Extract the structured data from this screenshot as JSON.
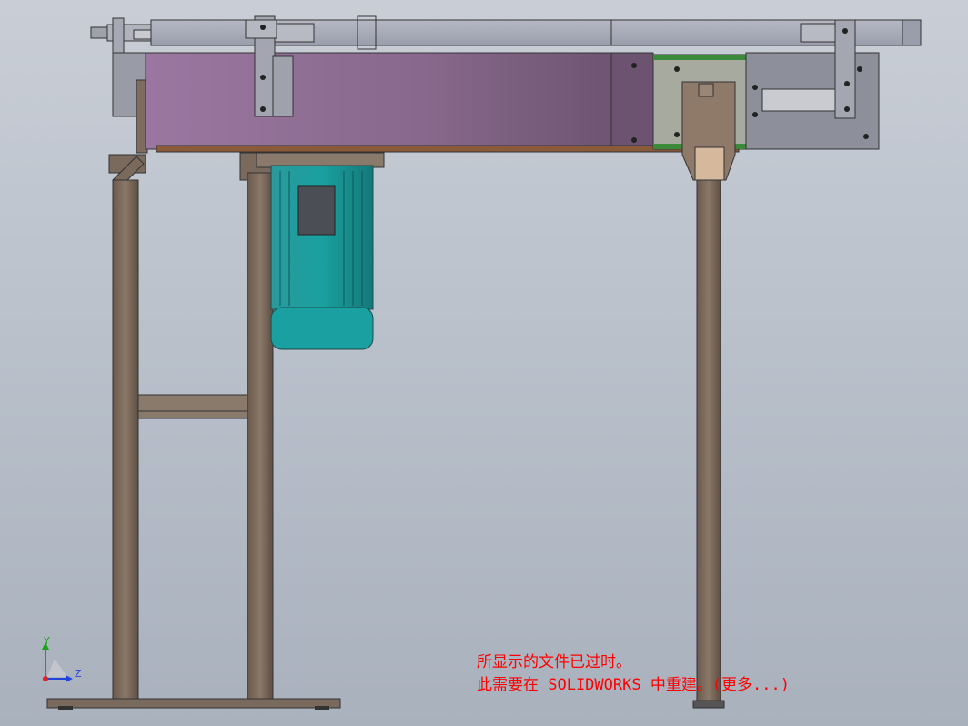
{
  "viewport": {
    "background_top": "#c9ced6",
    "background_bottom": "#a9b1bd"
  },
  "model": {
    "frame_color": "#7a6a5e",
    "belt_color": "#8c6c8e",
    "motor_color": "#1f8c8e",
    "plate_color": "#8d8f98"
  },
  "triad": {
    "y_label": "Y",
    "z_label": "Z"
  },
  "notice": {
    "line1": "所显示的文件已过时。",
    "line2": "此需要在 SOLIDWORKS 中重建。(更多...)",
    "color": "#ff0000"
  }
}
